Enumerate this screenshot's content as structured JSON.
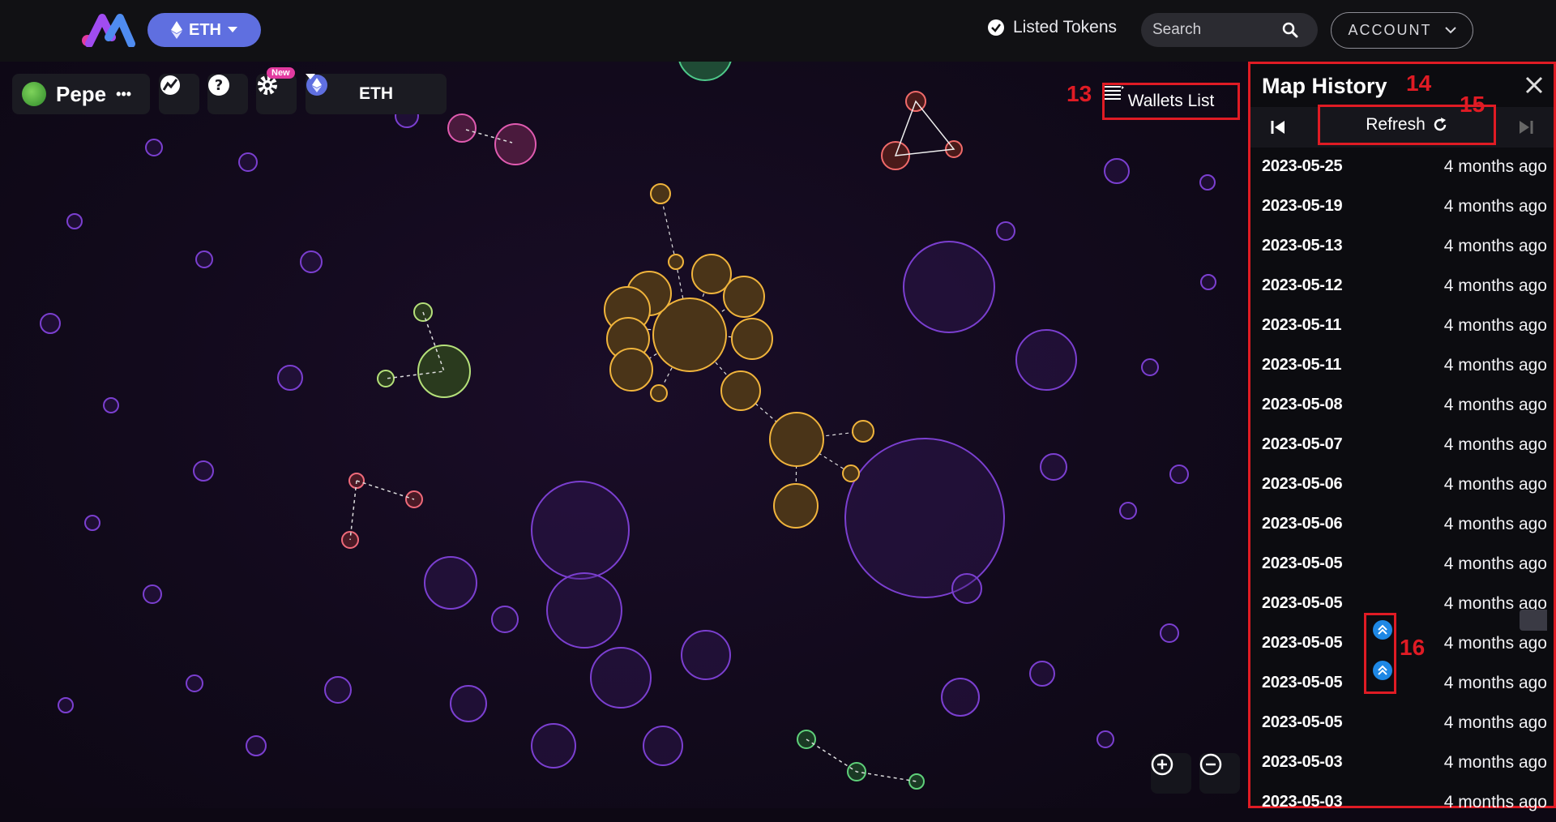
{
  "topbar": {
    "network_label": "ETH",
    "listed_tokens_label": "Listed Tokens",
    "search_placeholder": "Search",
    "account_label": "ACCOUNT"
  },
  "map_toolbar": {
    "token_name": "Pepe",
    "token_menu": "•••",
    "new_badge": "New",
    "chain_label": "ETH",
    "wallets_list_label": "Wallets List"
  },
  "annotations": {
    "wallets": "13",
    "history": "14",
    "refresh": "15",
    "snapshot": "16"
  },
  "history_panel": {
    "title": "Map History",
    "refresh_label": "Refresh",
    "items": [
      {
        "date": "2023-05-25",
        "ago": "4 months ago"
      },
      {
        "date": "2023-05-19",
        "ago": "4 months ago"
      },
      {
        "date": "2023-05-13",
        "ago": "4 months ago"
      },
      {
        "date": "2023-05-12",
        "ago": "4 months ago"
      },
      {
        "date": "2023-05-11",
        "ago": "4 months ago"
      },
      {
        "date": "2023-05-11",
        "ago": "4 months ago"
      },
      {
        "date": "2023-05-08",
        "ago": "4 months ago"
      },
      {
        "date": "2023-05-07",
        "ago": "4 months ago"
      },
      {
        "date": "2023-05-06",
        "ago": "4 months ago"
      },
      {
        "date": "2023-05-06",
        "ago": "4 months ago"
      },
      {
        "date": "2023-05-05",
        "ago": "4 months ago"
      },
      {
        "date": "2023-05-05",
        "ago": "4 months ago"
      },
      {
        "date": "2023-05-05",
        "ago": "4 months ago"
      },
      {
        "date": "2023-05-05",
        "ago": "4 months ago"
      },
      {
        "date": "2023-05-05",
        "ago": "4 months ago"
      },
      {
        "date": "2023-05-03",
        "ago": "4 months ago"
      },
      {
        "date": "2023-05-03",
        "ago": "4 months ago"
      }
    ]
  },
  "colors": {
    "accent": "#5f6fe0",
    "highlight": "#e01b24",
    "cluster_orange": "#f0b43c",
    "bubble_purple": "#7b3fd0",
    "snapshot_blue": "#1e88e5"
  }
}
